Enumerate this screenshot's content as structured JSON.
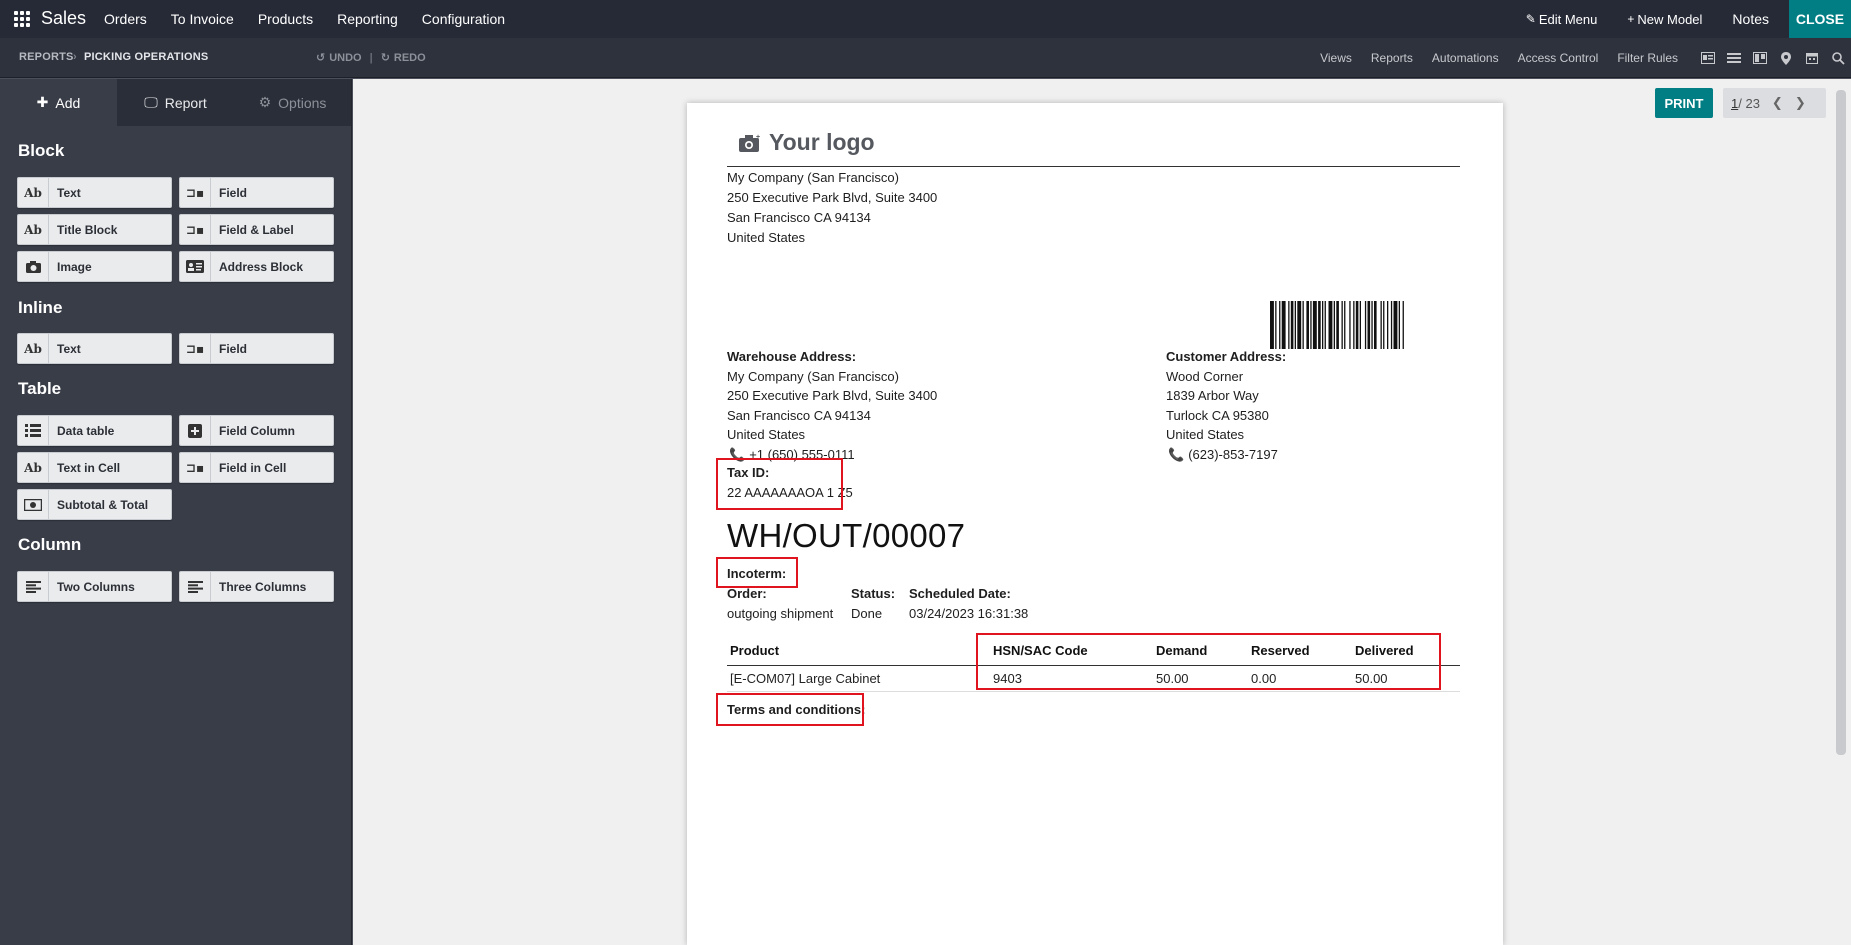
{
  "navbar": {
    "app": "Sales",
    "menu": [
      "Orders",
      "To Invoice",
      "Products",
      "Reporting",
      "Configuration"
    ],
    "edit_menu": "Edit Menu",
    "new_model": "New Model",
    "notes": "Notes",
    "close": "CLOSE"
  },
  "subbar": {
    "crumb_parent": "REPORTS",
    "crumb_current": "PICKING OPERATIONS",
    "undo": "UNDO",
    "redo": "REDO",
    "links": [
      "Views",
      "Reports",
      "Automations",
      "Access Control",
      "Filter Rules"
    ],
    "view_icons": [
      "form-view-icon",
      "list-view-icon",
      "kanban-view-icon",
      "map-view-icon",
      "calendar-view-icon",
      "search-icon"
    ]
  },
  "sidebar": {
    "tabs": {
      "add": "Add",
      "report": "Report",
      "options": "Options"
    },
    "sections": {
      "block": "Block",
      "inline": "Inline",
      "table": "Table",
      "column": "Column"
    },
    "block": {
      "text": "Text",
      "field": "Field",
      "title_block": "Title Block",
      "field_label": "Field & Label",
      "image": "Image",
      "address_block": "Address Block"
    },
    "inline": {
      "text": "Text",
      "field": "Field"
    },
    "table": {
      "data_table": "Data table",
      "field_column": "Field Column",
      "text_in_cell": "Text in Cell",
      "field_in_cell": "Field in Cell",
      "subtotal_total": "Subtotal & Total"
    },
    "column": {
      "two_columns": "Two Columns",
      "three_columns": "Three Columns"
    },
    "icon_text": "Ab"
  },
  "toolbar": {
    "print": "PRINT",
    "pager_current": "1",
    "pager_total": " / 23"
  },
  "report": {
    "logo": "Your logo",
    "company": [
      "My Company (San Francisco)",
      "250 Executive Park Blvd, Suite 3400",
      "San Francisco CA 94134",
      "United States"
    ],
    "warehouse_label": "Warehouse Address:",
    "warehouse": [
      "My Company (San Francisco)",
      "250 Executive Park Blvd, Suite 3400",
      "San Francisco CA 94134",
      "United States"
    ],
    "warehouse_phone": "+1 (650) 555-0111",
    "customer_label": "Customer Address:",
    "customer": [
      "Wood Corner",
      "1839 Arbor Way",
      "Turlock CA 95380",
      "United States"
    ],
    "customer_phone": "(623)-853-7197",
    "tax_label": "Tax ID:",
    "tax_value": "22 AAAAAAAOA 1 Z5",
    "picking_name": "WH/OUT/00007",
    "incoterm_label": "Incoterm:",
    "order_label": "Order:",
    "order_value": "outgoing shipment",
    "status_label": "Status:",
    "status_value": "Done",
    "scheduled_label": "Scheduled Date:",
    "scheduled_value": "03/24/2023 16:31:38",
    "table": {
      "headers": [
        "Product",
        "HSN/SAC Code",
        "Demand",
        "Reserved",
        "Delivered"
      ],
      "rows": [
        [
          "[E-COM07] Large Cabinet",
          "9403",
          "50.00",
          "0.00",
          "50.00"
        ]
      ]
    },
    "terms_label": "Terms and conditions:"
  },
  "colors": {
    "navbar": "#262a36",
    "accent": "#017e84",
    "sidebar": "#393d48",
    "highlight_box": "#e0141e"
  }
}
